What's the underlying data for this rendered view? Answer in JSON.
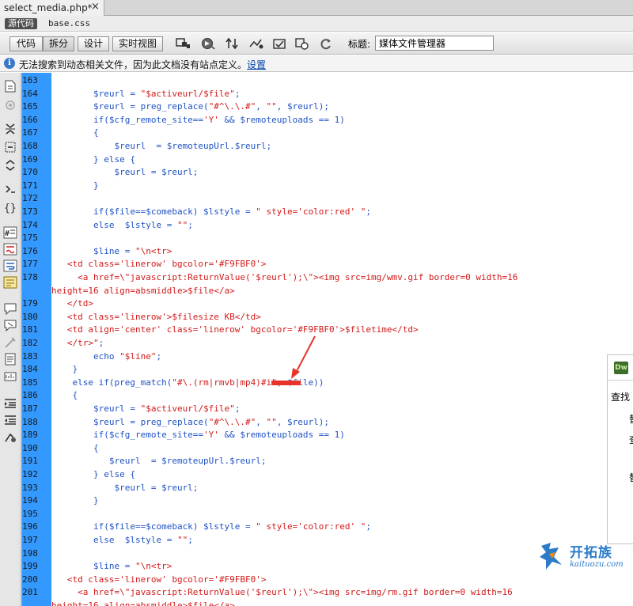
{
  "document_tab": {
    "name": "select_media.php*",
    "close_label": "×"
  },
  "related_files": {
    "source_label": "源代码",
    "css_file": "base.css"
  },
  "toolbar": {
    "code_label": "代码",
    "split_label": "拆分",
    "design_label": "设计",
    "live_label": "实时视图",
    "title_label": "标题:",
    "title_value": "媒体文件管理器",
    "icons": [
      "multiscreen-icon",
      "preview-icon",
      "file-management-icon",
      "validate-icon",
      "check-browser-icon",
      "visual-aids-icon",
      "refresh-icon"
    ]
  },
  "info_bar": {
    "message": "无法搜索到动态相关文件，因为此文档没有站点定义。",
    "link": "设置"
  },
  "left_tools": [
    "open-documents-icon",
    "show-code-navigator-icon",
    "collapse-full-tag-icon",
    "collapse-selection-icon",
    "expand-all-icon",
    "select-parent-tag-icon",
    "balance-braces-icon",
    "line-numbers-icon",
    "highlight-invalid-code-icon",
    "word-wrap-icon",
    "syntax-coloring-icon",
    "apply-comment-icon",
    "remove-comment-icon",
    "wrap-tag-icon",
    "recent-snippets-icon",
    "move-css-icon",
    "indent-code-icon",
    "outdent-code-icon",
    "format-source-icon"
  ],
  "code_lines": [
    {
      "n": "163",
      "segs": []
    },
    {
      "n": "164",
      "segs": [
        [
          "p",
          "        $reurl = "
        ],
        [
          "s",
          "\"$activeurl/$file\""
        ],
        [
          "p",
          ";"
        ]
      ]
    },
    {
      "n": "165",
      "segs": [
        [
          "p",
          "        $reurl = preg_replace("
        ],
        [
          "s",
          "\"#^\\.\\.#\""
        ],
        [
          "p",
          ", "
        ],
        [
          "s",
          "\"\""
        ],
        [
          "p",
          ", $reurl);"
        ]
      ]
    },
    {
      "n": "166",
      "segs": [
        [
          "p",
          "        if($cfg_remote_site=="
        ],
        [
          "s",
          "'Y'"
        ],
        [
          "p",
          " && $remoteuploads == 1)"
        ]
      ]
    },
    {
      "n": "167",
      "segs": [
        [
          "p",
          "        {"
        ]
      ]
    },
    {
      "n": "168",
      "segs": [
        [
          "p",
          "            $reurl  = $remoteupUrl.$reurl;"
        ]
      ]
    },
    {
      "n": "169",
      "segs": [
        [
          "p",
          "        } else {"
        ]
      ]
    },
    {
      "n": "170",
      "segs": [
        [
          "p",
          "            $reurl = $reurl;"
        ]
      ]
    },
    {
      "n": "171",
      "segs": [
        [
          "p",
          "        }"
        ]
      ]
    },
    {
      "n": "172",
      "segs": []
    },
    {
      "n": "173",
      "segs": [
        [
          "p",
          "        if($file==$comeback) $lstyle = "
        ],
        [
          "s",
          "\" style='color:red' \""
        ],
        [
          "p",
          ";"
        ]
      ]
    },
    {
      "n": "174",
      "segs": [
        [
          "p",
          "        else  $lstyle = "
        ],
        [
          "s",
          "\"\""
        ],
        [
          "p",
          ";"
        ]
      ]
    },
    {
      "n": "175",
      "segs": []
    },
    {
      "n": "176",
      "segs": [
        [
          "p",
          "        $line = "
        ],
        [
          "s",
          "\"\\n<tr>"
        ]
      ]
    },
    {
      "n": "177",
      "segs": [
        [
          "s",
          "   <td class='linerow' bgcolor='#F9FBF0'>"
        ]
      ]
    },
    {
      "n": "178",
      "segs": [
        [
          "s",
          "     <a href=\\\"javascript:ReturnValue('$reurl');\\\"><img src=img/wmv.gif border=0 width=16"
        ]
      ]
    },
    {
      "n": "",
      "segs": [
        [
          "s",
          "height=16 align=absmiddle>$file</a>"
        ]
      ]
    },
    {
      "n": "179",
      "segs": [
        [
          "s",
          "   </td>"
        ]
      ]
    },
    {
      "n": "180",
      "segs": [
        [
          "s",
          "   <td class='linerow'>$filesize KB</td>"
        ]
      ]
    },
    {
      "n": "181",
      "segs": [
        [
          "s",
          "   <td align='center' class='linerow' bgcolor='#F9FBF0'>$filetime</td>"
        ]
      ]
    },
    {
      "n": "182",
      "segs": [
        [
          "s",
          "   </tr>\""
        ],
        [
          "p",
          ";"
        ]
      ]
    },
    {
      "n": "183",
      "segs": [
        [
          "p",
          "        echo "
        ],
        [
          "s",
          "\"$line\""
        ],
        [
          "p",
          ";"
        ]
      ]
    },
    {
      "n": "184",
      "segs": [
        [
          "p",
          "    }"
        ]
      ]
    },
    {
      "n": "185",
      "segs": [
        [
          "p",
          "    else if(preg_match("
        ],
        [
          "s",
          "\"#\\.(rm|rmvb|mp4)#i\""
        ],
        [
          "p",
          ", $file))"
        ]
      ]
    },
    {
      "n": "186",
      "segs": [
        [
          "p",
          "    {"
        ]
      ]
    },
    {
      "n": "187",
      "segs": [
        [
          "p",
          "        $reurl = "
        ],
        [
          "s",
          "\"$activeurl/$file\""
        ],
        [
          "p",
          ";"
        ]
      ]
    },
    {
      "n": "188",
      "segs": [
        [
          "p",
          "        $reurl = preg_replace("
        ],
        [
          "s",
          "\"#^\\.\\.#\""
        ],
        [
          "p",
          ", "
        ],
        [
          "s",
          "\"\""
        ],
        [
          "p",
          ", $reurl);"
        ]
      ]
    },
    {
      "n": "189",
      "segs": [
        [
          "p",
          "        if($cfg_remote_site=="
        ],
        [
          "s",
          "'Y'"
        ],
        [
          "p",
          " && $remoteuploads == 1)"
        ]
      ]
    },
    {
      "n": "190",
      "segs": [
        [
          "p",
          "        {"
        ]
      ]
    },
    {
      "n": "191",
      "segs": [
        [
          "p",
          "           $reurl  = $remoteupUrl.$reurl;"
        ]
      ]
    },
    {
      "n": "192",
      "segs": [
        [
          "p",
          "        } else {"
        ]
      ]
    },
    {
      "n": "193",
      "segs": [
        [
          "p",
          "            $reurl = $reurl;"
        ]
      ]
    },
    {
      "n": "194",
      "segs": [
        [
          "p",
          "        }"
        ]
      ]
    },
    {
      "n": "195",
      "segs": []
    },
    {
      "n": "196",
      "segs": [
        [
          "p",
          "        if($file==$comeback) $lstyle = "
        ],
        [
          "s",
          "\" style='color:red' \""
        ],
        [
          "p",
          ";"
        ]
      ]
    },
    {
      "n": "197",
      "segs": [
        [
          "p",
          "        else  $lstyle = "
        ],
        [
          "s",
          "\"\""
        ],
        [
          "p",
          ";"
        ]
      ]
    },
    {
      "n": "198",
      "segs": []
    },
    {
      "n": "199",
      "segs": [
        [
          "p",
          "        $line = "
        ],
        [
          "s",
          "\"\\n<tr>"
        ]
      ]
    },
    {
      "n": "200",
      "segs": [
        [
          "s",
          "   <td class='linerow' bgcolor='#F9FBF0'>"
        ]
      ]
    },
    {
      "n": "201",
      "segs": [
        [
          "s",
          "     <a href=\\\"javascript:ReturnValue('$reurl');\\\"><img src=img/rm.gif border=0 width=16"
        ]
      ]
    },
    {
      "n": "",
      "segs": [
        [
          "s",
          "height=16 align=absmiddle>$file</a>"
        ]
      ]
    }
  ],
  "side_panel": {
    "logo": "Dw",
    "find_label": "查找",
    "fragments": [
      "替",
      "查",
      "替"
    ]
  },
  "watermark": {
    "name": "开拓族",
    "url": "kaituozu.com"
  },
  "colors": {
    "gutter": "#3399ff",
    "php": "#1f52c4",
    "string": "#d21a1a",
    "annotation": "#e8332b"
  }
}
